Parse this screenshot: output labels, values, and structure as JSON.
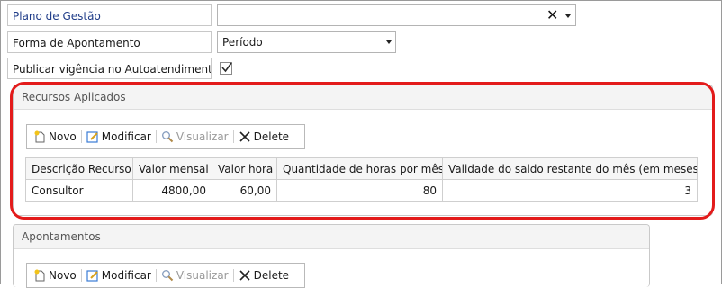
{
  "form": {
    "plano_label": "Plano de Gestão",
    "plano_value": "",
    "forma_label": "Forma de Apontamento",
    "forma_value": "Período",
    "publicar_label": "Publicar vigência no Autoatendimento",
    "publicar_checked": true
  },
  "recursos": {
    "title": "Recursos Aplicados",
    "toolbar": {
      "novo": "Novo",
      "modificar": "Modificar",
      "visualizar": "Visualizar",
      "delete": "Delete"
    },
    "columns": [
      "Descrição Recurso",
      "Valor mensal",
      "Valor hora",
      "Quantidade de horas por mês",
      "Validade do saldo restante do mês (em meses)"
    ],
    "rows": [
      [
        "Consultor",
        "4800,00",
        "60,00",
        "80",
        "3"
      ]
    ]
  },
  "apontamentos": {
    "title": "Apontamentos",
    "toolbar": {
      "novo": "Novo",
      "modificar": "Modificar",
      "visualizar": "Visualizar",
      "delete": "Delete"
    }
  },
  "colors": {
    "highlight": "#e31b1b",
    "label_blue": "#1f3c88"
  },
  "icons": {
    "novo": "new-document-icon",
    "modificar": "edit-icon",
    "visualizar": "magnifier-icon",
    "delete": "x-icon",
    "dropdown": "chevron-down-icon",
    "clear": "clear-x-icon",
    "check": "checkmark-icon"
  }
}
